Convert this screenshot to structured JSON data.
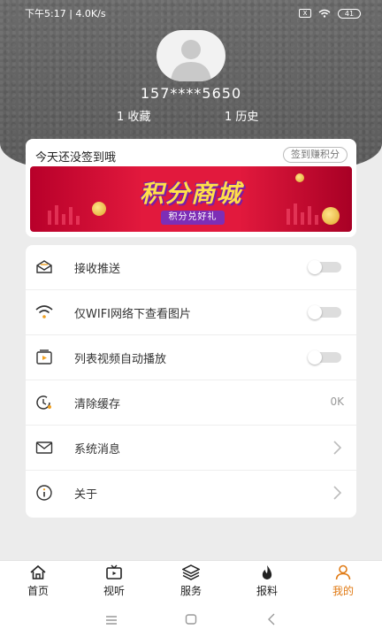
{
  "status_bar": {
    "time_speed": "下午5:17 | 4.0K/s",
    "battery": "41",
    "sim": "X"
  },
  "profile": {
    "phone": "157****5650",
    "favorites": "1 收藏",
    "history": "1 历史"
  },
  "signin": {
    "text": "今天还没签到哦",
    "button": "签到赚积分"
  },
  "banner": {
    "title": "积分商城",
    "subtitle": "积分兑好礼",
    "colors": {
      "bg": "#e2193d",
      "title": "#ffe04a",
      "accent": "#7d2eb6"
    }
  },
  "settings": [
    {
      "label": "接收推送",
      "icon": "envelope-open-icon",
      "control": "toggle",
      "state": "off"
    },
    {
      "label": "仅WIFI网络下查看图片",
      "icon": "wifi-icon",
      "control": "toggle",
      "state": "off"
    },
    {
      "label": "列表视频自动播放",
      "icon": "video-icon",
      "control": "toggle",
      "state": "off"
    },
    {
      "label": "清除缓存",
      "icon": "clock-refresh-icon",
      "control": "value",
      "value": "0K"
    },
    {
      "label": "系统消息",
      "icon": "mail-icon",
      "control": "chevron"
    },
    {
      "label": "关于",
      "icon": "info-icon",
      "control": "chevron"
    }
  ],
  "tabs": [
    {
      "label": "首页",
      "icon": "home-icon"
    },
    {
      "label": "视听",
      "icon": "tv-icon"
    },
    {
      "label": "服务",
      "icon": "layers-icon"
    },
    {
      "label": "报料",
      "icon": "flame-icon"
    },
    {
      "label": "我的",
      "icon": "person-icon",
      "active": true
    }
  ],
  "accent_color": "#e07a14"
}
